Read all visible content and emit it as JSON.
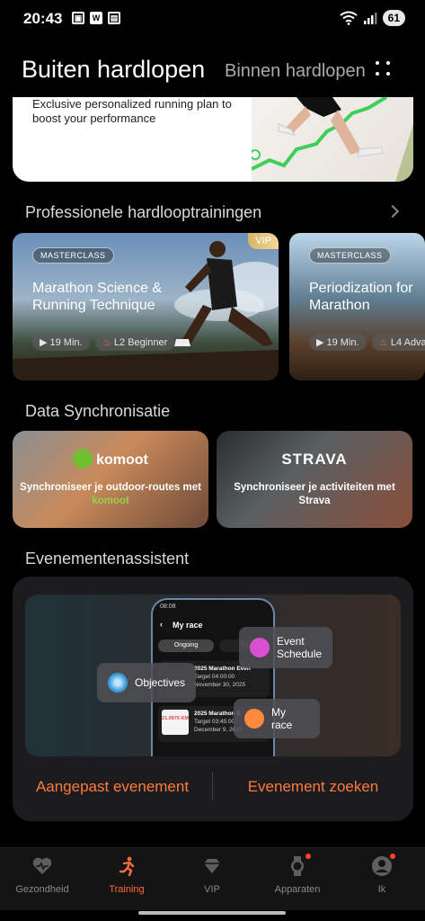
{
  "status_bar": {
    "time": "20:43",
    "battery": "61",
    "left_icons": [
      "qr-icon",
      "w-icon",
      "app-icon"
    ],
    "right_icons": [
      "wifi-icon",
      "signal-icon"
    ]
  },
  "header": {
    "tab_active": "Buiten hardlopen",
    "tab_inactive": "Binnen hardlopen",
    "more_icon": "more-dots-icon"
  },
  "banner": {
    "text": "Exclusive personalized running plan to boost your performance"
  },
  "trainings": {
    "section_title": "Professionele hardlooptrainingen",
    "cards": [
      {
        "badge": "MASTERCLASS",
        "title": "Marathon Science & Running Technique",
        "duration": "19 Min.",
        "level": "L2 Beginner",
        "vip": "VIP"
      },
      {
        "badge": "MASTERCLASS",
        "title": "Periodization for Marathon",
        "duration": "19 Min.",
        "level": "L4 Adva"
      }
    ]
  },
  "sync": {
    "section_title": "Data Synchronisatie",
    "cards": [
      {
        "brand": "komoot",
        "desc_prefix": "Synchroniseer je outdoor-routes met ",
        "desc_highlight": "komoot"
      },
      {
        "brand": "STRAVA",
        "desc": "Synchroniseer je activiteiten met Strava"
      }
    ]
  },
  "events": {
    "section_title": "Evenementenassistent",
    "phone": {
      "time": "08:08",
      "title": "My race",
      "tab_ongoing": "Ongoing",
      "tab_ended": "En",
      "race1_title": "2025 Marathon Even",
      "race1_target": "Target 04:00:00",
      "race1_date": "November 30, 2025",
      "race2_title": "2025 Marathon E",
      "race2_target": "Target 03:45:00",
      "race2_date": "December 9, 2025",
      "race2_thumb": "21.0975 KM"
    },
    "float_objectives": "Objectives",
    "float_schedule": "Event Schedule",
    "float_myrace": "My race",
    "btn_custom": "Aangepast evenement",
    "btn_search": "Evenement zoeken"
  },
  "nav": {
    "items": [
      {
        "label": "Gezondheid",
        "icon": "heart-icon"
      },
      {
        "label": "Training",
        "icon": "runner-icon",
        "active": true
      },
      {
        "label": "VIP",
        "icon": "diamond-icon"
      },
      {
        "label": "Apparaten",
        "icon": "watch-icon",
        "dot": true
      },
      {
        "label": "Ik",
        "icon": "profile-icon",
        "dot": true
      }
    ]
  },
  "colors": {
    "accent": "#ff6a3d",
    "background": "#000000",
    "card": "#1c1c1e"
  }
}
